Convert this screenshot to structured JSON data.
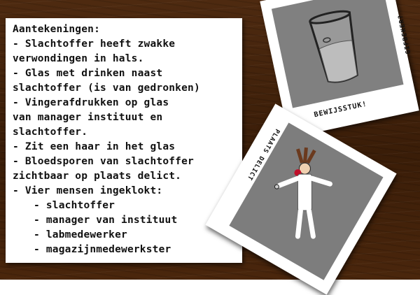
{
  "notes": {
    "lines": [
      "Aantekeningen:",
      "- Slachtoffer heeft zwakke",
      "verwondingen in hals.",
      "- Glas met drinken naast",
      "slachtoffer (is van gedronken)",
      "- Vingerafdrukken op glas",
      "van manager instituut en",
      "slachtoffer.",
      "- Zit een haar in het glas",
      "- Bloedsporen van slachtoffer",
      "zichtbaar op plaats delict.",
      "- Vier mensen ingeklokt:",
      "- slachtoffer",
      "- manager van instituut",
      "- labmedewerker",
      "- magazijnmedewerkster"
    ]
  },
  "evidence_photo": {
    "caption": "BEWIJSSTUK!",
    "side_caption": "GIFBEKER?",
    "icon": "drinking-glass"
  },
  "scene_photo": {
    "caption": "PLAATS DELICT",
    "icon": "victim-figure"
  },
  "colors": {
    "desk": "#3f2008",
    "paper": "#ffffff",
    "photo": "#808080",
    "blood": "#b0102a"
  }
}
